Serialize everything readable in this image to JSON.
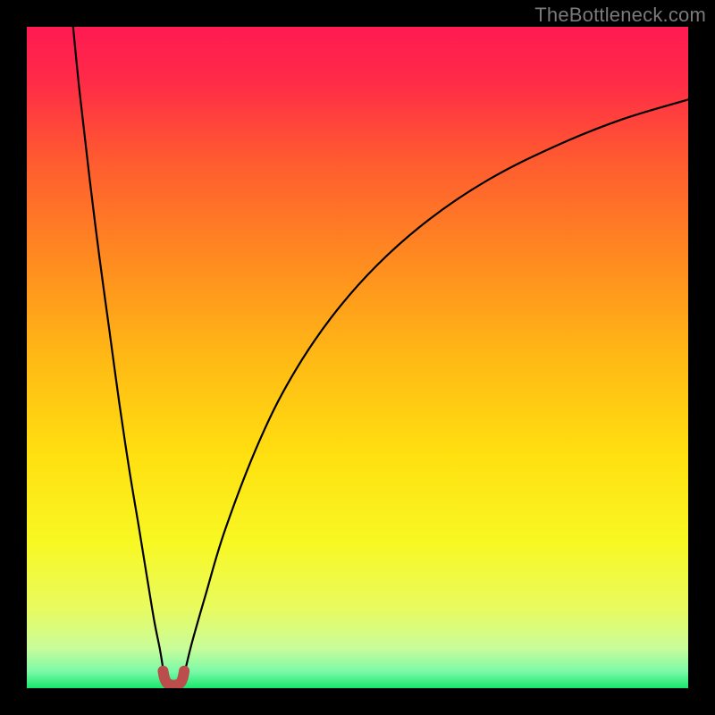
{
  "watermark": "TheBottleneck.com",
  "chart_data": {
    "type": "line",
    "title": "",
    "xlabel": "",
    "ylabel": "",
    "xlim": [
      0,
      100
    ],
    "ylim": [
      0,
      100
    ],
    "grid": false,
    "legend": false,
    "background_gradient_stops": [
      {
        "pos": 0.0,
        "color": "#ff1a52"
      },
      {
        "pos": 0.08,
        "color": "#ff2a48"
      },
      {
        "pos": 0.2,
        "color": "#ff5a30"
      },
      {
        "pos": 0.35,
        "color": "#ff8a20"
      },
      {
        "pos": 0.5,
        "color": "#ffb915"
      },
      {
        "pos": 0.65,
        "color": "#ffe010"
      },
      {
        "pos": 0.78,
        "color": "#f8f823"
      },
      {
        "pos": 0.88,
        "color": "#e8fb60"
      },
      {
        "pos": 0.94,
        "color": "#c9fc9a"
      },
      {
        "pos": 0.975,
        "color": "#7bf9a8"
      },
      {
        "pos": 1.0,
        "color": "#17e86c"
      }
    ],
    "series": [
      {
        "name": "left-branch",
        "x": [
          7.0,
          8.0,
          9.5,
          11.0,
          12.5,
          14.0,
          15.5,
          17.0,
          18.3,
          19.3,
          20.1,
          20.6,
          20.9
        ],
        "y": [
          100,
          90,
          77,
          65,
          54,
          43,
          33,
          24,
          16,
          10,
          6,
          3,
          1.2
        ]
      },
      {
        "name": "right-branch",
        "x": [
          23.4,
          24.0,
          25.0,
          27.0,
          30.0,
          35.0,
          40.0,
          46.0,
          53.0,
          61.0,
          70.0,
          80.0,
          90.0,
          100.0
        ],
        "y": [
          1.2,
          3,
          7,
          14,
          24,
          37,
          47,
          56,
          64,
          71,
          77,
          82,
          86,
          89
        ]
      },
      {
        "name": "valley-marker",
        "stroke": "#bb4d4d",
        "stroke_width": 12,
        "x": [
          20.6,
          20.8,
          21.1,
          21.6,
          22.2,
          22.8,
          23.3,
          23.6,
          23.8
        ],
        "y": [
          2.6,
          1.6,
          0.9,
          0.55,
          0.45,
          0.55,
          0.9,
          1.6,
          2.6
        ]
      }
    ]
  }
}
